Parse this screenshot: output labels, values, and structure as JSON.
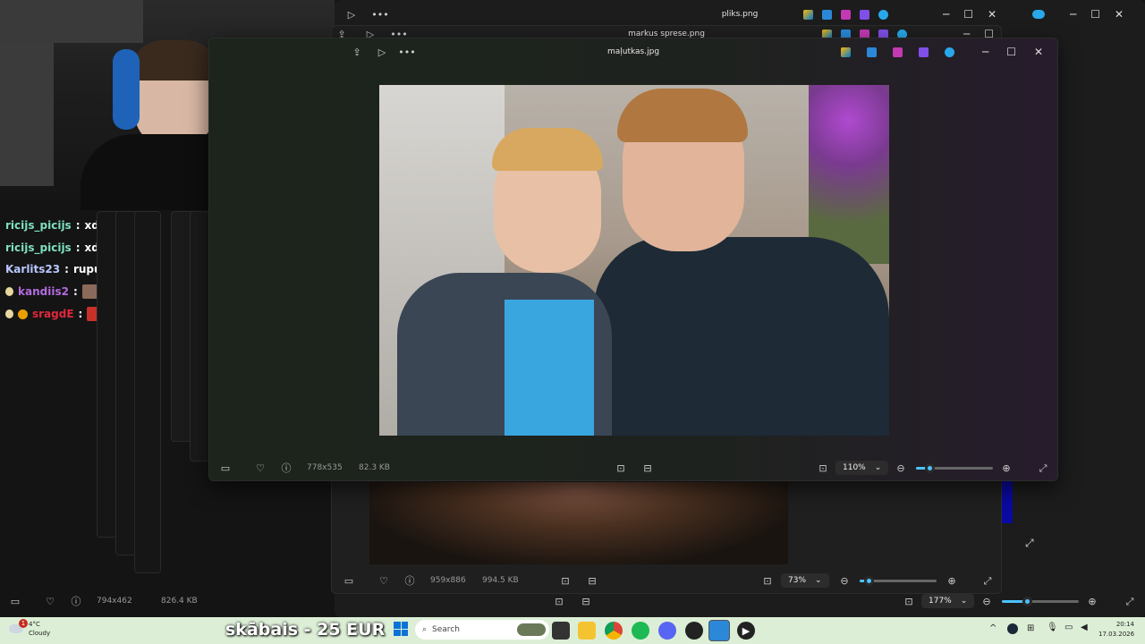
{
  "windows": {
    "back": {
      "title": "pliks.png",
      "dimensions": "794x462",
      "filesize": "826.4 KB",
      "zoom": "177%",
      "zoom_level": 0.33
    },
    "middle": {
      "title": "markus sprese.png",
      "dimensions": "959x886",
      "filesize": "994.5 KB",
      "zoom": "73%",
      "zoom_level": 0.12
    },
    "front": {
      "title": "maļutkas.jpg",
      "dimensions": "778x535",
      "filesize": "82.3 KB",
      "zoom": "110%",
      "zoom_level": 0.18
    }
  },
  "chat": [
    {
      "user": "ricijs_picijs",
      "message": "xd",
      "color": "#7fe0c0"
    },
    {
      "user": "ricijs_picijs",
      "message": "xd",
      "color": "#7fe0c0"
    },
    {
      "user": "Karlits23",
      "message": "rupuča faili",
      "color": "#b9c7ff"
    },
    {
      "user": "kandiis2",
      "message": "",
      "color": "#b26be0"
    },
    {
      "user": "sragdE",
      "message": "",
      "color": "#e0283a"
    }
  ],
  "banner": {
    "text": "skābais - 25 EUR"
  },
  "weather": {
    "temp": "4°C",
    "condition": "Cloudy",
    "badge": "1"
  },
  "taskbar": {
    "search_placeholder": "Search",
    "time": "20:14",
    "date": "17.03.2026",
    "apps": [
      "windows-start",
      "search",
      "widgets",
      "task-view",
      "file-explorer",
      "chrome",
      "spotify",
      "discord",
      "github",
      "photos",
      "media-player"
    ]
  },
  "colors": {
    "accent": "#4cc2ff",
    "taskbar": "#dff0d8"
  }
}
